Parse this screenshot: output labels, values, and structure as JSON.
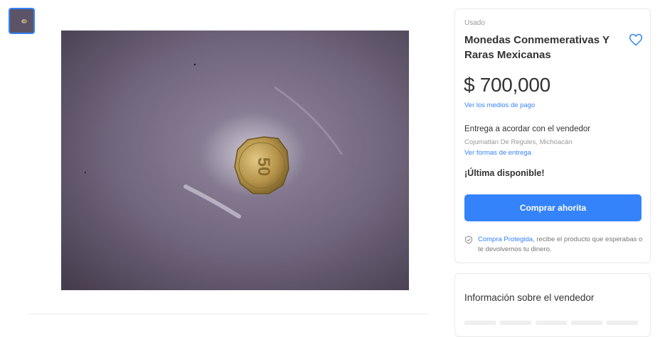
{
  "gallery": {
    "thumbnail_icon": "coin-thumbnail",
    "photo_icon": "coin-photo"
  },
  "product": {
    "condition": "Usado",
    "title": "Monedas Conmemerativas Y Raras Mexicanas",
    "price": "$ 700,000",
    "payment_link": "Ver los medios de pago",
    "favorite_icon": "heart-icon"
  },
  "delivery": {
    "title": "Entrega a acordar con el vendedor",
    "location": "Cojumatlan De Regules, Michoacán",
    "link": "Ver formas de entrega"
  },
  "stock": "¡Última disponible!",
  "buy_button": "Comprar ahorita",
  "protection": {
    "icon": "shield-check-icon",
    "link": "Compra Protegida",
    "text": ", recibe el producto que esperabas o te devolvemos tu dinero."
  },
  "seller": {
    "title": "Información sobre el vendedor"
  },
  "colors": {
    "accent": "#3483fa",
    "text": "#333333",
    "muted": "#999999"
  }
}
